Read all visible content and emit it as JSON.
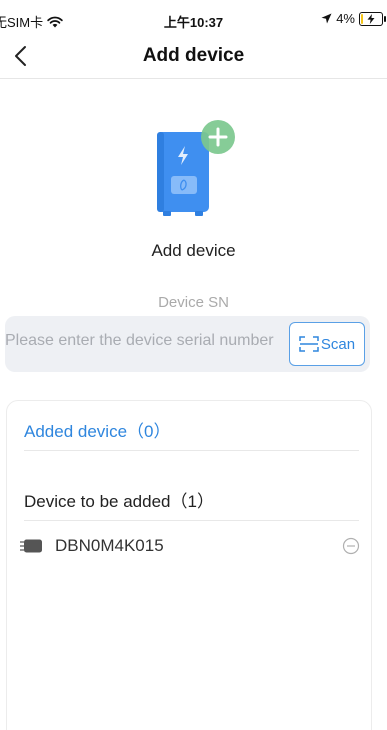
{
  "status_bar": {
    "carrier": "无SIM卡",
    "time": "上午10:37",
    "battery": "4%",
    "battery_level": 0.04
  },
  "header": {
    "title": "Add device"
  },
  "hero": {
    "label": "Add device"
  },
  "serial": {
    "label": "Device SN",
    "placeholder": "Please enter the device serial number",
    "value": "",
    "scan_label": "Scan"
  },
  "list": {
    "added_title": "Added device（0）",
    "to_be_added_title": "Device to be added（1）",
    "devices": [
      {
        "sn": "DBN0M4K015"
      }
    ]
  },
  "colors": {
    "accent": "#2f86de",
    "device_body": "#3f8ff0",
    "plus_badge": "#7cc88e"
  }
}
